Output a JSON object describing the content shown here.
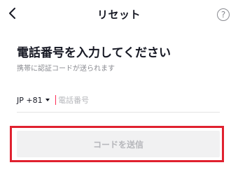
{
  "header": {
    "title": "リセット",
    "back_icon": "chevron-left-icon",
    "help_icon": "question-circle-icon",
    "help_glyph": "?"
  },
  "main": {
    "heading": "電話番号を入力してください",
    "subheading": "携帯に認証コードが送られます",
    "phone": {
      "country_code": "JP +81",
      "value": "",
      "placeholder": "電話番号"
    },
    "send_button_label": "コードを送信"
  },
  "colors": {
    "accent": "#fe2c55",
    "highlight": "#e0212f",
    "button_disabled_bg": "#f1f1f2",
    "button_disabled_text": "#b6b7bb"
  }
}
